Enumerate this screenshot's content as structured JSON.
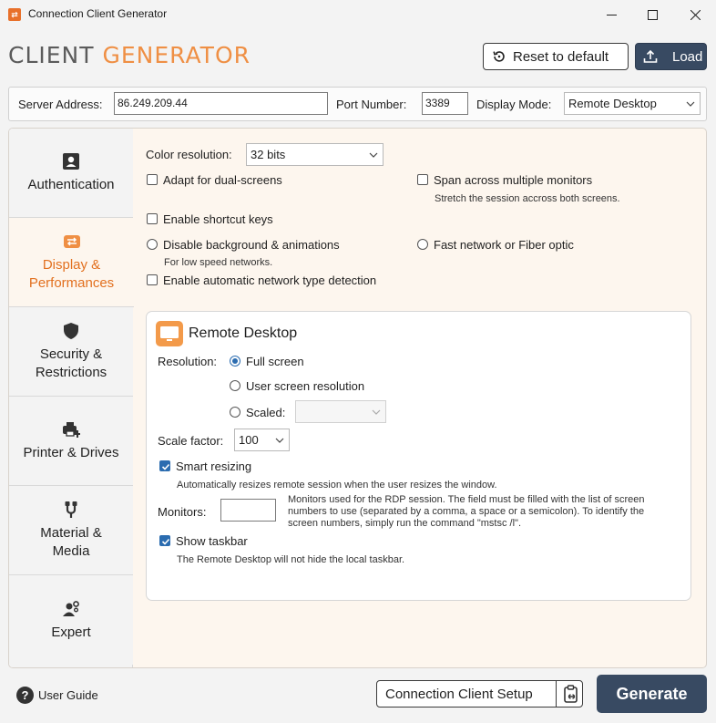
{
  "window": {
    "title": "Connection Client Generator",
    "app_icon": "connection-client-app-icon"
  },
  "header": {
    "logo_part1": "CLIENT",
    "logo_part2": "GENERATOR",
    "logo_color1": "#5b5b5b",
    "logo_color2": "#ef8f44",
    "reset_label": "Reset to default",
    "load_label": "Load"
  },
  "server": {
    "address_label": "Server Address:",
    "address_value": "86.249.209.44",
    "port_label": "Port Number:",
    "port_value": "3389",
    "mode_label": "Display Mode:",
    "mode_value": "Remote Desktop"
  },
  "sidebar": {
    "items": [
      {
        "line1": "Authentication",
        "line2": "",
        "icon": "user-badge-icon",
        "active": false
      },
      {
        "line1": "Display &",
        "line2": "Performances",
        "icon": "display-switch-icon",
        "active": true
      },
      {
        "line1": "Security &",
        "line2": "Restrictions",
        "icon": "shield-icon",
        "active": false
      },
      {
        "line1": "Printer & Drives",
        "line2": "",
        "icon": "printer-add-icon",
        "active": false
      },
      {
        "line1": "Material &",
        "line2": "Media",
        "icon": "usb-cable-icon",
        "active": false
      },
      {
        "line1": "Expert",
        "line2": "",
        "icon": "user-gear-icon",
        "active": false
      }
    ],
    "accent_color": "#e2701f"
  },
  "display": {
    "color_res_label": "Color resolution:",
    "color_res_value": "32 bits",
    "dual_screens": {
      "label": "Adapt for dual-screens",
      "checked": false
    },
    "span_monitors": {
      "label": "Span across multiple monitors",
      "checked": false,
      "hint": "Stretch the session accross both screens."
    },
    "shortcut_keys": {
      "label": "Enable shortcut keys",
      "checked": false
    },
    "disable_bg": {
      "label": "Disable background & animations",
      "selected": false,
      "hint": "For low speed networks."
    },
    "fast_network": {
      "label": "Fast network or Fiber optic",
      "selected": false
    },
    "auto_network": {
      "label": "Enable automatic network type detection",
      "checked": false
    }
  },
  "remote_desktop": {
    "title": "Remote Desktop",
    "resolution_label": "Resolution:",
    "full_screen": {
      "label": "Full screen",
      "selected": true
    },
    "user_screen": {
      "label": "User screen resolution",
      "selected": false
    },
    "scaled": {
      "label": "Scaled:",
      "selected": false,
      "value": ""
    },
    "scale_factor_label": "Scale factor:",
    "scale_factor_value": "100",
    "smart_resizing": {
      "label": "Smart resizing",
      "checked": true,
      "hint": "Automatically resizes remote session when the user resizes the window."
    },
    "monitors_label": "Monitors:",
    "monitors_value": "",
    "monitors_hint1": "Monitors used for the RDP session. The field must be filled with the list of screen",
    "monitors_hint2": "numbers to use (separated by a comma, a space or a semicolon). To identify the",
    "monitors_hint3": "screen numbers, simply run the command \"mstsc /l\".",
    "show_taskbar": {
      "label": "Show taskbar",
      "checked": true,
      "hint": "The Remote Desktop will not hide the local taskbar."
    }
  },
  "footer": {
    "user_guide": "User Guide",
    "setup_label": "Connection Client Setup",
    "generate_label": "Generate",
    "primary_color": "#384a62"
  }
}
